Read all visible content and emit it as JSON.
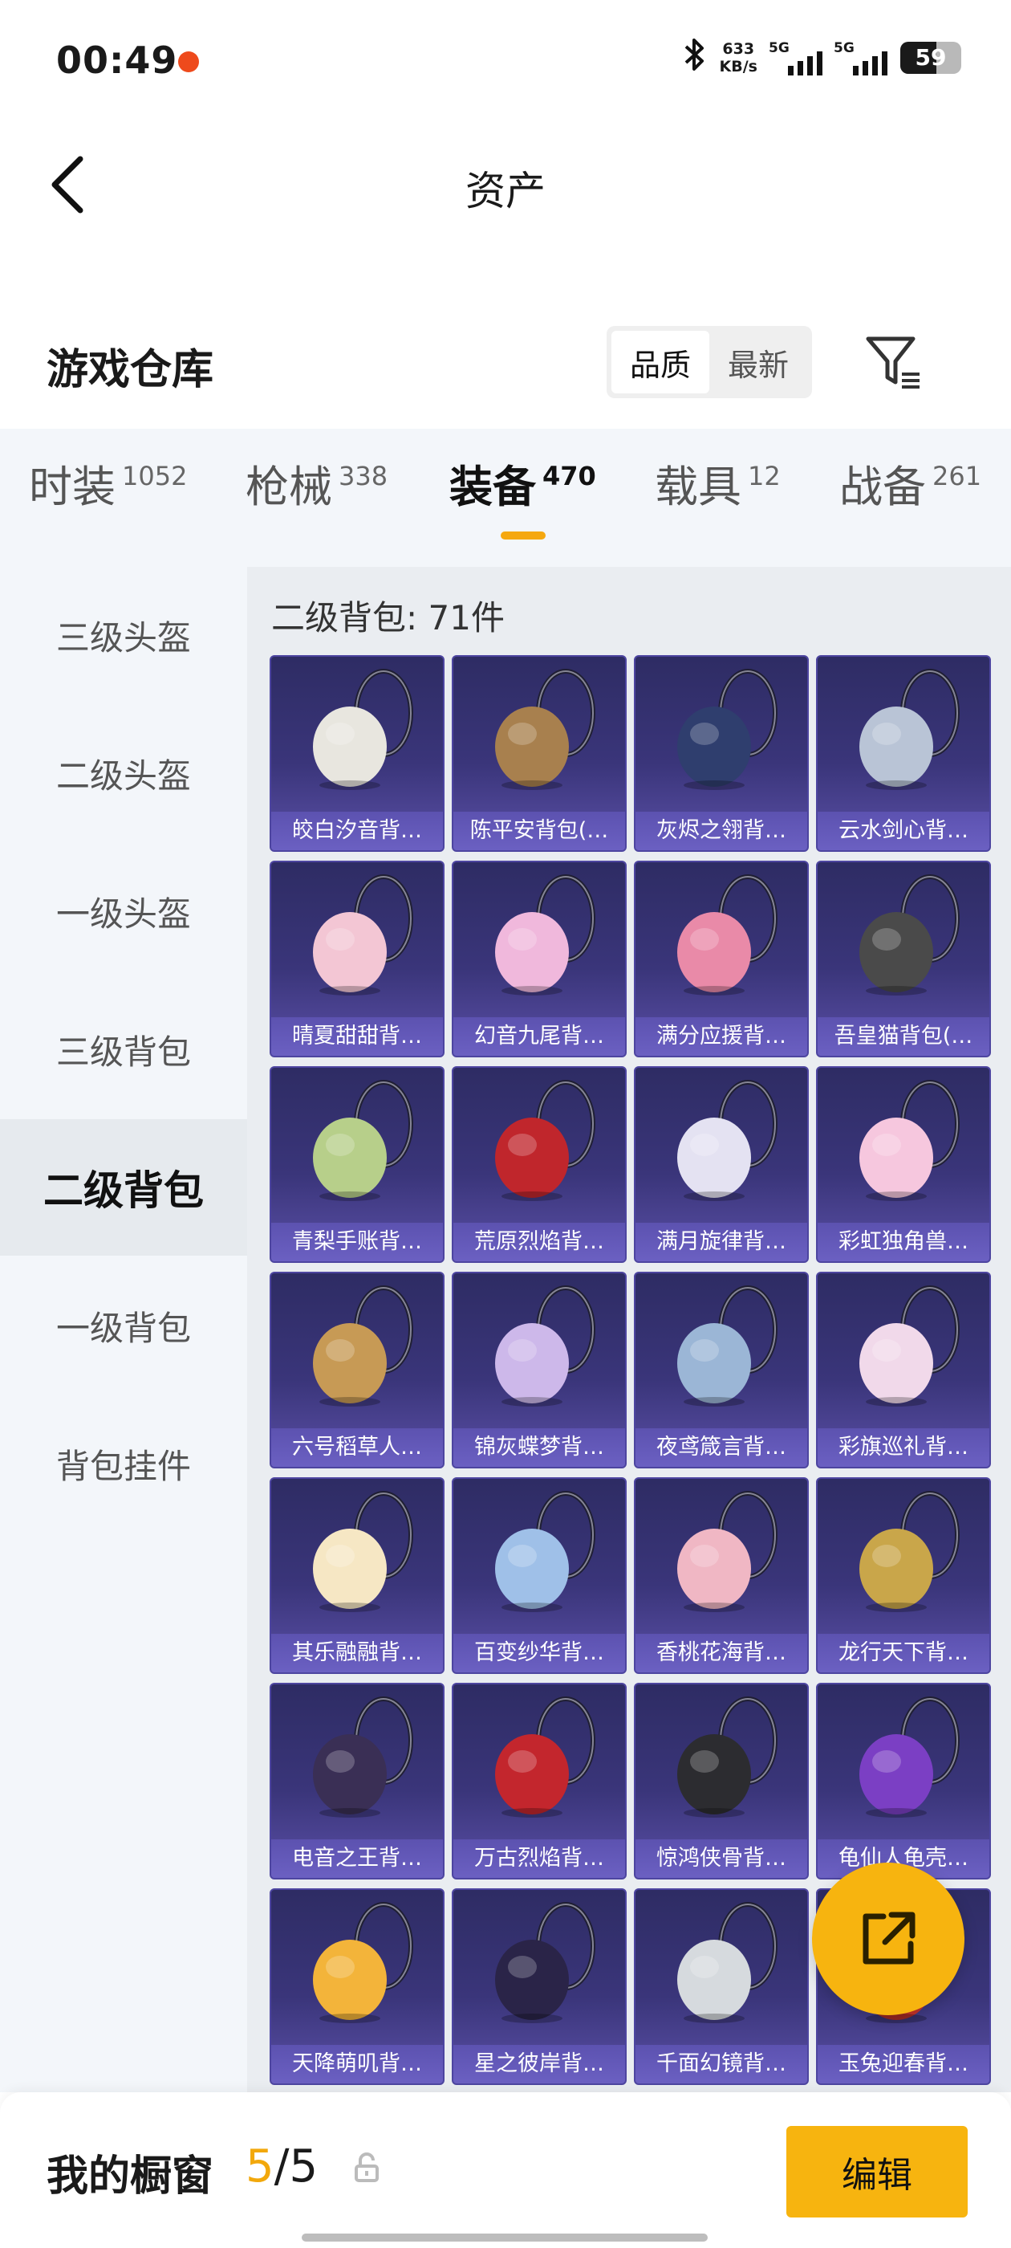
{
  "status_bar": {
    "time": "00:49",
    "net_speed_value": "633",
    "net_speed_unit": "KB/s",
    "signal1_label": "5G",
    "signal2_label": "5G",
    "battery": "59",
    "battery_level": 0.59
  },
  "header": {
    "title": "资产"
  },
  "warehouse": {
    "title": "游戏仓库",
    "sort_options": [
      "品质",
      "最新"
    ],
    "sort_active": "品质"
  },
  "category_tabs": [
    {
      "name": "时装",
      "count": "1052",
      "active": false
    },
    {
      "name": "枪械",
      "count": "338",
      "active": false
    },
    {
      "name": "装备",
      "count": "470",
      "active": true
    },
    {
      "name": "载具",
      "count": "12",
      "active": false
    },
    {
      "name": "战备",
      "count": "261",
      "active": false
    }
  ],
  "sidebar": {
    "items": [
      {
        "label": "三级头盔",
        "active": false
      },
      {
        "label": "二级头盔",
        "active": false
      },
      {
        "label": "一级头盔",
        "active": false
      },
      {
        "label": "三级背包",
        "active": false
      },
      {
        "label": "二级背包",
        "active": true
      },
      {
        "label": "一级背包",
        "active": false
      },
      {
        "label": "背包挂件",
        "active": false
      }
    ]
  },
  "content": {
    "title": "二级背包: 71件",
    "items": [
      {
        "label": "皎白汐音背…",
        "color": "#e8e6df"
      },
      {
        "label": "陈平安背包(…",
        "color": "#a8804e"
      },
      {
        "label": "灰烬之翎背…",
        "color": "#2f3e6e"
      },
      {
        "label": "云水剑心背…",
        "color": "#b9c4d6"
      },
      {
        "label": "晴夏甜甜背…",
        "color": "#f3c6d4"
      },
      {
        "label": "幻音九尾背…",
        "color": "#f0b8dc"
      },
      {
        "label": "满分应援背…",
        "color": "#e98aa8"
      },
      {
        "label": "吾皇猫背包(…",
        "color": "#4a4a4a"
      },
      {
        "label": "青梨手账背…",
        "color": "#b7cf8a"
      },
      {
        "label": "荒原烈焰背…",
        "color": "#c0262c"
      },
      {
        "label": "满月旋律背…",
        "color": "#e4e2f2"
      },
      {
        "label": "彩虹独角兽…",
        "color": "#f6c7de"
      },
      {
        "label": "六号稻草人…",
        "color": "#c79a55"
      },
      {
        "label": "锦灰蝶梦背…",
        "color": "#cdb8ea"
      },
      {
        "label": "夜鸢箴言背…",
        "color": "#9bb6d6"
      },
      {
        "label": "彩旗巡礼背…",
        "color": "#f1d9ea"
      },
      {
        "label": "其乐融融背…",
        "color": "#f6e7c4"
      },
      {
        "label": "百变纱华背…",
        "color": "#9fc0e8"
      },
      {
        "label": "香桃花海背…",
        "color": "#f0b7c4"
      },
      {
        "label": "龙行天下背…",
        "color": "#c9a64a"
      },
      {
        "label": "电音之王背…",
        "color": "#3a2f55"
      },
      {
        "label": "万古烈焰背…",
        "color": "#c3262d"
      },
      {
        "label": "惊鸿侠骨背…",
        "color": "#2c2c30"
      },
      {
        "label": "龟仙人龟壳…",
        "color": "#7b3fc4"
      },
      {
        "label": "天降萌叽背…",
        "color": "#f3b43a"
      },
      {
        "label": "星之彼岸背…",
        "color": "#2a2448"
      },
      {
        "label": "千面幻镜背…",
        "color": "#d6dade"
      },
      {
        "label": "玉兔迎春背…",
        "color": "#c7332c"
      }
    ]
  },
  "fab": {
    "icon": "share-icon"
  },
  "bottom_bar": {
    "label": "我的橱窗",
    "count_current": "5",
    "count_total": "/5",
    "edit_label": "编辑"
  },
  "colors": {
    "accent": "#f7b40f",
    "card_bg": "#3a357a",
    "card_label_bg": "#6b60c2"
  }
}
